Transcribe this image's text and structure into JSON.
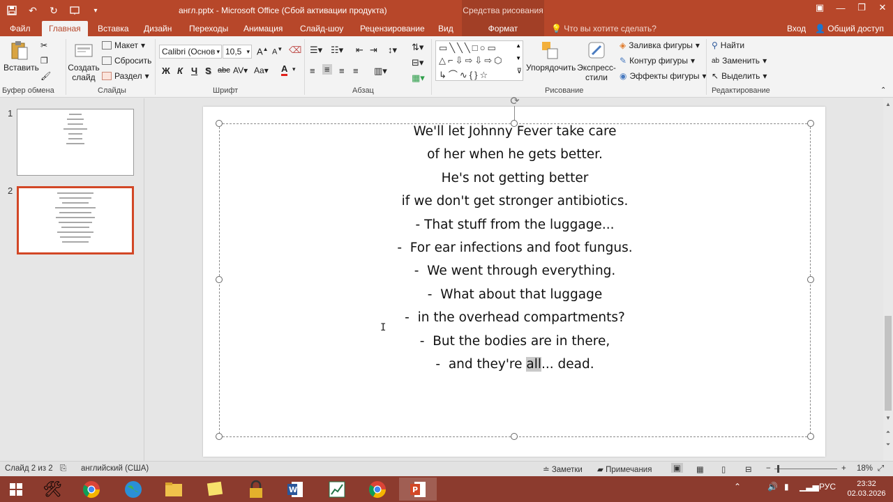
{
  "window": {
    "title": "англ.pptx - Microsoft Office (Сбой активации продукта)",
    "context_title": "Средства рисования"
  },
  "tabs": {
    "file": "Файл",
    "home": "Главная",
    "insert": "Вставка",
    "design": "Дизайн",
    "transitions": "Переходы",
    "animation": "Анимация",
    "slideshow": "Слайд-шоу",
    "review": "Рецензирование",
    "view": "Вид",
    "format": "Формат",
    "tell_me": "Что вы хотите сделать?",
    "sign_in": "Вход",
    "share": "Общий доступ"
  },
  "ribbon": {
    "clipboard": {
      "paste": "Вставить",
      "label": "Буфер обмена"
    },
    "slides": {
      "new_slide": "Создать слайд",
      "layout": "Макет",
      "reset": "Сбросить",
      "section": "Раздел",
      "label": "Слайды"
    },
    "font": {
      "name": "Calibri (Основ",
      "size": "10,5",
      "label": "Шрифт",
      "bold": "Ж",
      "italic": "К",
      "underline": "Ч",
      "shadow": "S",
      "strike": "abc",
      "spacing": "AV",
      "case": "Aa",
      "color": "A",
      "grow": "A",
      "shrink": "A"
    },
    "paragraph": {
      "label": "Абзац"
    },
    "drawing": {
      "arrange": "Упорядочить",
      "quick_styles": "Экспресс-стили",
      "fill": "Заливка фигуры",
      "outline": "Контур фигуры",
      "effects": "Эффекты фигуры",
      "label": "Рисование"
    },
    "editing": {
      "find": "Найти",
      "replace": "Заменить",
      "select": "Выделить",
      "label": "Редактирование"
    }
  },
  "slides_panel": [
    {
      "num": "1"
    },
    {
      "num": "2"
    }
  ],
  "slide_text": {
    "lines": [
      "We'll let Johnny Fever take care",
      "of her when he gets better.",
      "He's not getting better",
      "if we don't get stronger antibiotics.",
      "- That stuff from the luggage...",
      "-  For ear infections and foot fungus.",
      "-  We went through everything.",
      "-  What about that luggage",
      "-  in the overhead compartments?",
      "-  But the bodies are in there,"
    ],
    "last_prefix": "-  and they're ",
    "last_highlight": "all",
    "last_suffix": "... dead."
  },
  "status": {
    "slide": "Слайд 2 из 2",
    "language": "английский (США)",
    "notes": "Заметки",
    "comments": "Примечания",
    "zoom": "18%"
  },
  "taskbar": {
    "lang": "РУС",
    "time": "23:32",
    "date": "02.03.2026"
  },
  "colors": {
    "accent": "#b7472a",
    "selection": "#d24726"
  }
}
